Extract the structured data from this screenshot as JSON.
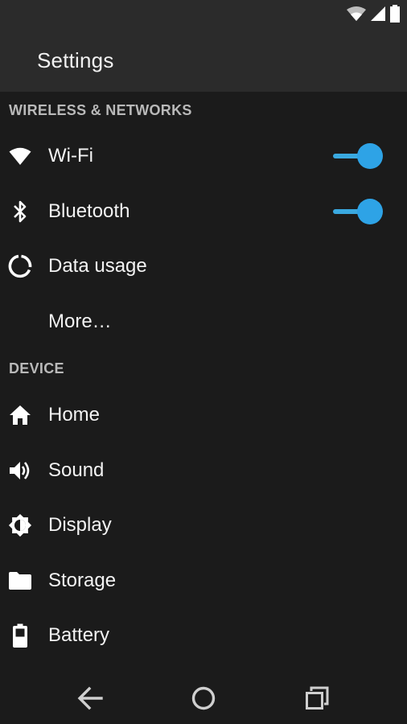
{
  "app": {
    "title": "Settings"
  },
  "sections": {
    "wireless": {
      "header": "WIRELESS & NETWORKS",
      "items": [
        {
          "label": "Wi-Fi",
          "icon": "wifi-icon",
          "toggle": true
        },
        {
          "label": "Bluetooth",
          "icon": "bluetooth-icon",
          "toggle": true
        },
        {
          "label": "Data usage",
          "icon": "data-usage-icon"
        },
        {
          "label": "More…",
          "icon": ""
        }
      ]
    },
    "device": {
      "header": "DEVICE",
      "items": [
        {
          "label": "Home",
          "icon": "home-icon"
        },
        {
          "label": "Sound",
          "icon": "sound-icon"
        },
        {
          "label": "Display",
          "icon": "display-brightness-icon"
        },
        {
          "label": "Storage",
          "icon": "folder-icon"
        },
        {
          "label": "Battery",
          "icon": "battery-icon"
        }
      ]
    }
  },
  "colors": {
    "accent": "#2ea3e6",
    "background": "#1b1b1b",
    "bar": "#2b2b2b",
    "section_header": "#b9b9b9"
  },
  "navigation": {
    "back_icon": "back-arrow-icon",
    "home_icon": "home-circle-icon",
    "recents_icon": "recents-icon"
  }
}
